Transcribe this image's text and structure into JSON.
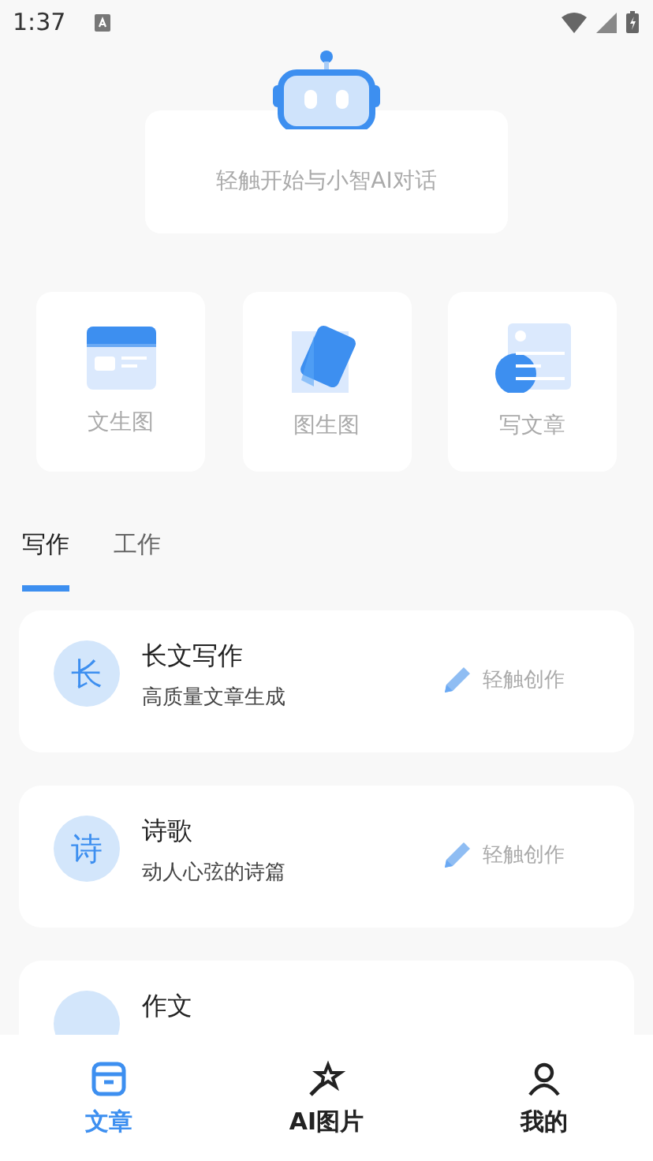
{
  "status_bar": {
    "time": "1:37"
  },
  "chat_prompt": {
    "text": "轻触开始与小智AI对话"
  },
  "features": [
    {
      "kind": "text-to-image",
      "label": "文生图"
    },
    {
      "kind": "image-to-image",
      "label": "图生图"
    },
    {
      "kind": "write-article",
      "label": "写文章"
    }
  ],
  "tabs": [
    {
      "label": "写作",
      "selected": true
    },
    {
      "label": "工作",
      "selected": false
    }
  ],
  "items": [
    {
      "avatar": "长",
      "title": "长文写作",
      "subtitle": "高质量文章生成",
      "action": "轻触创作"
    },
    {
      "avatar": "诗",
      "title": "诗歌",
      "subtitle": "动人心弦的诗篇",
      "action": "轻触创作"
    },
    {
      "title": "作文"
    }
  ],
  "bottom_nav": [
    {
      "kind": "article",
      "label": "文章",
      "selected": true
    },
    {
      "kind": "ai-image",
      "label": "AI图片",
      "selected": false
    },
    {
      "kind": "profile",
      "label": "我的",
      "selected": false
    }
  ]
}
